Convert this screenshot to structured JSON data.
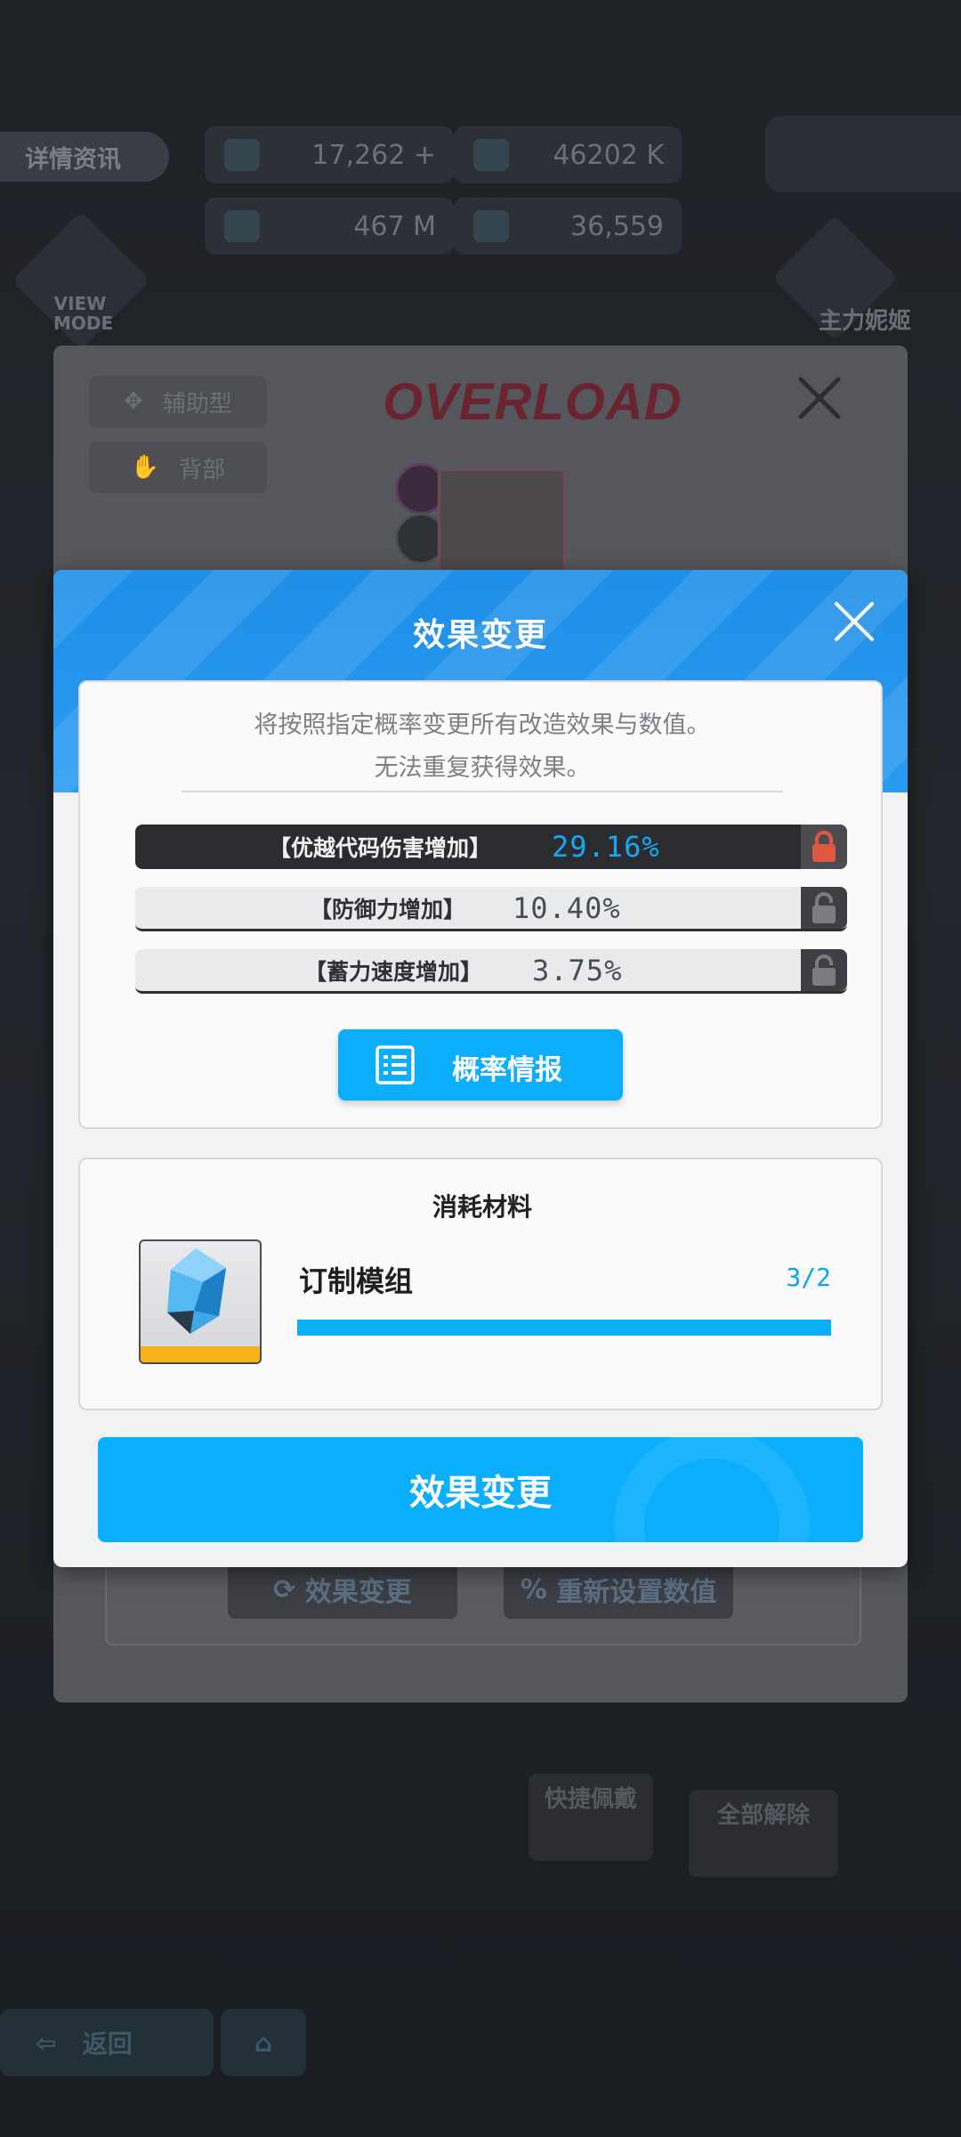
{
  "background": {
    "info_pill": "详情资讯",
    "stats": [
      {
        "value": "17,262 +"
      },
      {
        "value": "46202 K"
      },
      {
        "value": "467 M"
      },
      {
        "value": "36,559"
      }
    ],
    "view_mode": "VIEW MODE",
    "main_label": "主力妮姬",
    "panel_title": "OVERLOAD",
    "tags": [
      "辅助型",
      "背部"
    ],
    "buttons": [
      "效果变更",
      "重新设置数值"
    ],
    "quick_equip": "快捷佩戴",
    "unequip_all": "全部解除",
    "back": "返回"
  },
  "modal": {
    "title": "效果变更",
    "description_line1": "将按照指定概率变更所有改造效果与数值。",
    "description_line2": "无法重复获得效果。",
    "effects": [
      {
        "label": "【优越代码伤害增加】",
        "value": "29.16%",
        "locked": true
      },
      {
        "label": "【防御力增加】",
        "value": "10.40%",
        "locked": false
      },
      {
        "label": "【蓄力速度增加】",
        "value": "3.75%",
        "locked": false
      }
    ],
    "probability_button": "概率情报",
    "materials": {
      "title": "消耗材料",
      "item_name": "订制模组",
      "count": "3/2",
      "progress": 1.0
    },
    "apply_button": "效果变更"
  },
  "colors": {
    "accent": "#0caefc",
    "header_blue": "#1e8ee8",
    "locked_row": "#2b2c30",
    "lock_red": "#e0573f"
  }
}
